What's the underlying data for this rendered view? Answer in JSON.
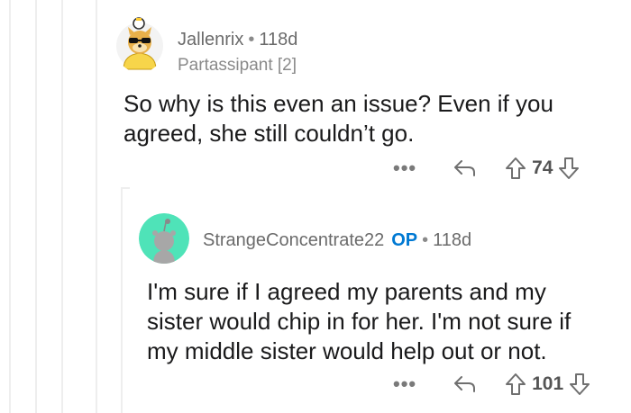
{
  "comments": [
    {
      "username": "Jallenrix",
      "separator": "•",
      "age": "118d",
      "flair": "Partassipant [2]",
      "body": "So why is this even an issue? Even if you agreed, she still couldn’t go.",
      "more": "•••",
      "score": "74",
      "accent": "#f2c12e"
    },
    {
      "username": "StrangeConcentrate22",
      "op_badge": "OP",
      "separator": "•",
      "age": "118d",
      "body": "I'm sure if I agreed my parents and my sister would chip in for her. I'm not sure if my middle sister would help out or not.",
      "more": "•••",
      "score": "101",
      "accent": "#4fe3b8"
    }
  ],
  "icons": {
    "reply": "reply-arrow-icon",
    "upvote": "upvote-arrow-icon",
    "downvote": "downvote-arrow-icon"
  }
}
